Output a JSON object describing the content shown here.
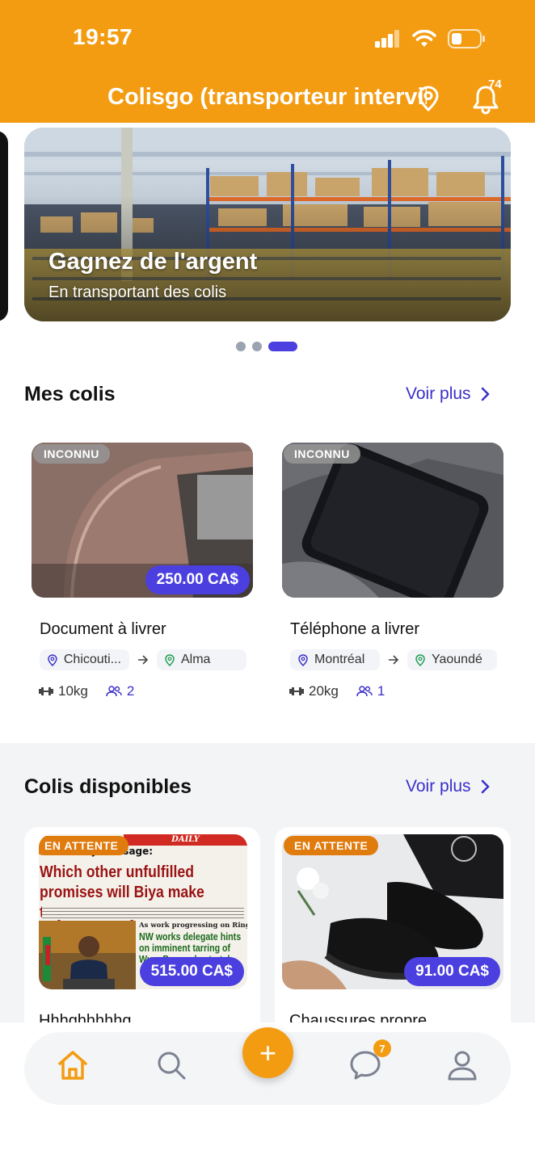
{
  "status_bar": {
    "time": "19:57"
  },
  "header": {
    "title": "Colisgo (transporteur interville",
    "notification_count": "74"
  },
  "banner": {
    "title": "Gagnez de l'argent",
    "subtitle": "En transportant des colis",
    "total_slides": 3,
    "active_slide": 3
  },
  "mes_colis": {
    "title": "Mes colis",
    "voir_plus": "Voir plus",
    "items": [
      {
        "status": "INCONNU",
        "price": "250.00 CA$",
        "title": "Document à livrer",
        "from": "Chicouti...",
        "to": "Alma",
        "weight": "10kg",
        "travelers": "2"
      },
      {
        "status": "INCONNU",
        "price": "",
        "title": "Téléphone a livrer",
        "from": "Montréal",
        "to": "Yaoundé",
        "weight": "20kg",
        "travelers": "1"
      }
    ]
  },
  "colis_disponibles": {
    "title": "Colis disponibles",
    "voir_plus": "Voir plus",
    "items": [
      {
        "status": "EN ATTENTE",
        "price": "515.00 CA$",
        "title": "Hhhghhhhhg",
        "newspaper": {
          "masthead": "DAILY",
          "kicker": "Youth Day message:",
          "headline": "Which other unfulfilled promises will Biya make to youth today?",
          "side_kicker": "As work progressing on Ring Road:",
          "side_headline": "NW works delegate hints on imminent tarring of Wum-Bamenda stretch"
        }
      },
      {
        "status": "EN ATTENTE",
        "price": "91.00 CA$",
        "title": "Chaussures propre"
      }
    ]
  },
  "bottom_nav": {
    "chat_badge": "7",
    "fab_symbol": "+"
  },
  "colors": {
    "primary_orange": "#F39C12",
    "accent_blue": "#4B3FE0",
    "link_blue": "#3B30C9"
  }
}
